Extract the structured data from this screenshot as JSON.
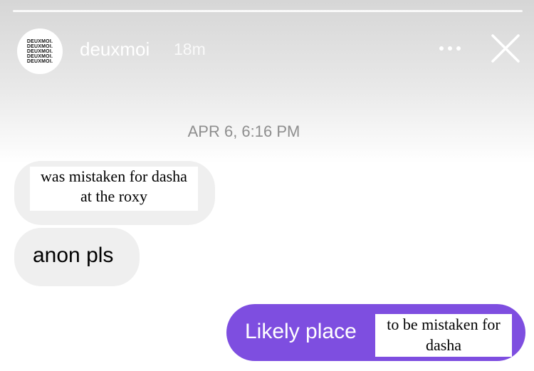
{
  "story": {
    "progress_segments": 1,
    "account": {
      "avatar_lines": [
        "DEUXMOI.",
        "DEUXMOI.",
        "DEUXMOI.",
        "DEUXMOI.",
        "DEUXMOI."
      ],
      "username": "deuxmoi",
      "posted_ago": "18m"
    },
    "more_icon": "more-horizontal-icon",
    "close_icon": "close-icon"
  },
  "conversation": {
    "timestamp": "APR 6, 6:16 PM",
    "messages": [
      {
        "direction": "incoming",
        "overlay_text_line1": "was mistaken for dasha",
        "overlay_text_line2": "at the roxy"
      },
      {
        "direction": "incoming",
        "text": "anon pls"
      },
      {
        "direction": "outgoing",
        "text": "Likely place",
        "overlay_text_line1": "to be mistaken for",
        "overlay_text_line2": "dasha"
      }
    ]
  },
  "colors": {
    "outgoing_bubble": "#7e4ee0",
    "incoming_bubble": "#efefef",
    "timestamp": "#8e8e8e"
  }
}
